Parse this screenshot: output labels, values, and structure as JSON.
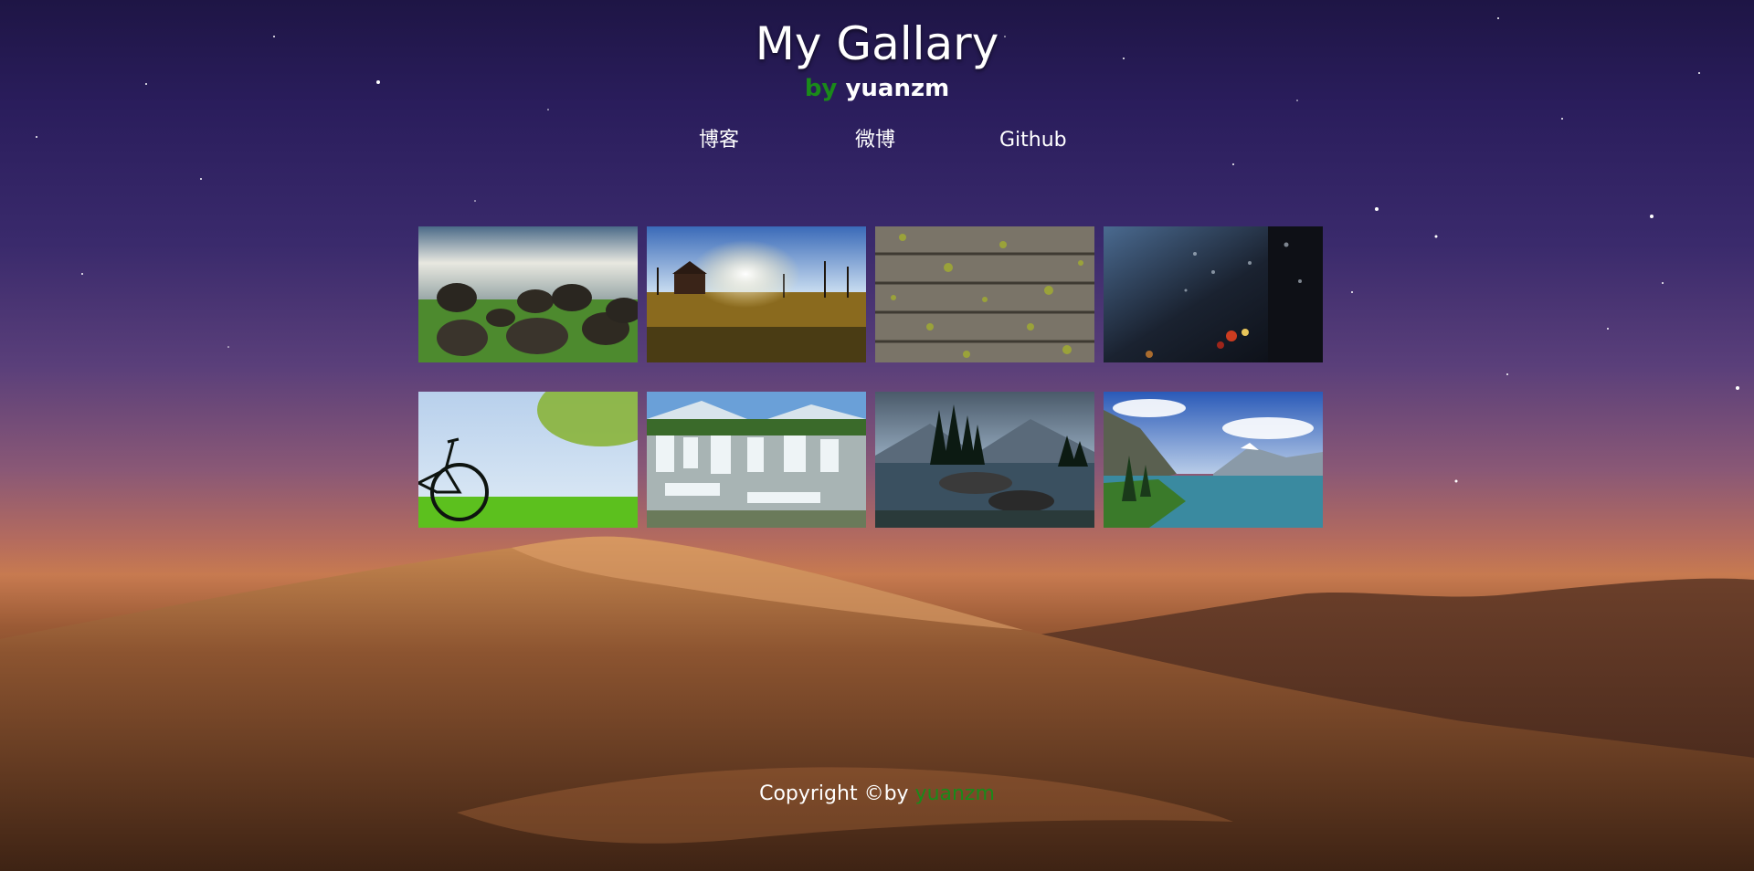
{
  "header": {
    "title": "My Gallary",
    "subtitle_by": "by",
    "subtitle_name": "yuanzm"
  },
  "nav": {
    "items": [
      {
        "label": "博客"
      },
      {
        "label": "微博"
      },
      {
        "label": "Github"
      }
    ]
  },
  "gallery": {
    "images": [
      {
        "subject": "boulders-on-grass"
      },
      {
        "subject": "farm-at-sunset"
      },
      {
        "subject": "wooden-planks-with-leaves"
      },
      {
        "subject": "raindrops-on-window"
      },
      {
        "subject": "bicycle-on-meadow"
      },
      {
        "subject": "waterfall"
      },
      {
        "subject": "lake-island-with-pines"
      },
      {
        "subject": "mountain-lake"
      }
    ]
  },
  "footer": {
    "copyright": "Copyright ©by ",
    "author": "yuanzm"
  },
  "colors": {
    "accent_green": "#1a8a1a",
    "text": "#ffffff"
  }
}
